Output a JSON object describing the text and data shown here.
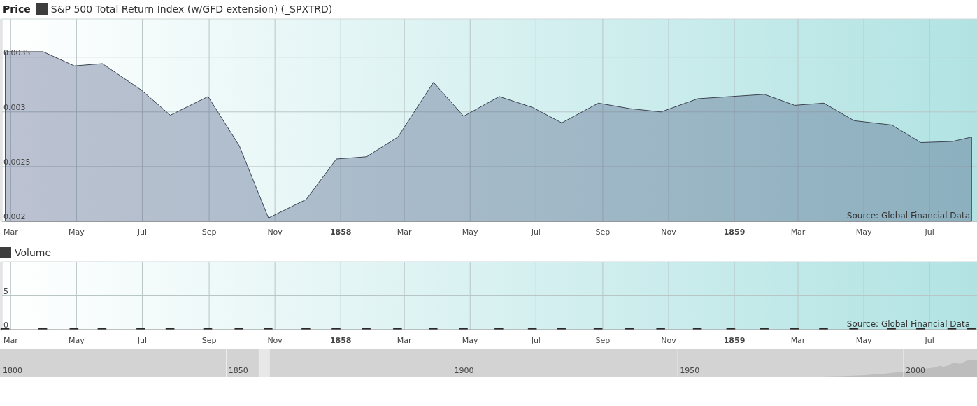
{
  "price_panel": {
    "label": "Price",
    "source": "Source: Global Financial Data",
    "chart_data": {
      "type": "area",
      "grid": true,
      "xlim": [
        "1857-02-21",
        "1859-08-14"
      ],
      "ylim": [
        0.002,
        0.00385
      ],
      "x": [
        "1857-02-24",
        "1857-03-31",
        "1857-04-29",
        "1857-05-25",
        "1857-06-30",
        "1857-07-27",
        "1857-08-31",
        "1857-09-29",
        "1857-10-26",
        "1857-11-30",
        "1857-12-28",
        "1858-01-25",
        "1858-02-23",
        "1858-03-28",
        "1858-04-25",
        "1858-05-28",
        "1858-06-28",
        "1858-07-25",
        "1858-08-28",
        "1858-09-26",
        "1858-10-25",
        "1858-11-28",
        "1858-12-29",
        "1859-01-29",
        "1859-02-26",
        "1859-03-25",
        "1859-04-22",
        "1859-05-27",
        "1859-06-23",
        "1859-07-22",
        "1859-08-09"
      ],
      "series": [
        {
          "name": "S&P 500 Total Return Index (w/GFD extension) (_SPXTRD)",
          "values": [
            0.00355,
            0.00355,
            0.00342,
            0.00344,
            0.0032,
            0.00297,
            0.00314,
            0.00269,
            0.00203,
            0.0022,
            0.00257,
            0.00259,
            0.00277,
            0.00327,
            0.00296,
            0.00314,
            0.00304,
            0.0029,
            0.00308,
            0.00303,
            0.003,
            0.00312,
            0.00314,
            0.00316,
            0.00306,
            0.00308,
            0.00292,
            0.00288,
            0.00272,
            0.00273,
            0.00277
          ]
        }
      ],
      "yticks": [
        {
          "value": 0.002,
          "label": "0.002"
        },
        {
          "value": 0.0025,
          "label": "0.0025"
        },
        {
          "value": 0.003,
          "label": "0.003"
        },
        {
          "value": 0.0035,
          "label": "0.0035"
        }
      ],
      "xticks": [
        {
          "value": "1857-03-01",
          "label": "Mar"
        },
        {
          "value": "1857-05-01",
          "label": "May"
        },
        {
          "value": "1857-07-01",
          "label": "Jul"
        },
        {
          "value": "1857-09-01",
          "label": "Sep"
        },
        {
          "value": "1857-11-01",
          "label": "Nov"
        },
        {
          "value": "1858-01-01",
          "label": "1858"
        },
        {
          "value": "1858-03-01",
          "label": "Mar"
        },
        {
          "value": "1858-05-01",
          "label": "May"
        },
        {
          "value": "1858-07-01",
          "label": "Jul"
        },
        {
          "value": "1858-09-01",
          "label": "Sep"
        },
        {
          "value": "1858-11-01",
          "label": "Nov"
        },
        {
          "value": "1859-01-01",
          "label": "1859"
        },
        {
          "value": "1859-03-01",
          "label": "Mar"
        },
        {
          "value": "1859-05-01",
          "label": "May"
        },
        {
          "value": "1859-07-01",
          "label": "Jul"
        }
      ]
    }
  },
  "volume_panel": {
    "source": "Source: Global Financial Data",
    "chart_data": {
      "type": "bar",
      "grid": true,
      "xlim": [
        "1857-02-21",
        "1859-08-14"
      ],
      "ylim": [
        0,
        10
      ],
      "x": [
        "1857-02-24",
        "1857-03-31",
        "1857-04-29",
        "1857-05-25",
        "1857-06-30",
        "1857-07-27",
        "1857-08-31",
        "1857-09-29",
        "1857-10-26",
        "1857-11-30",
        "1857-12-28",
        "1858-01-25",
        "1858-02-23",
        "1858-03-28",
        "1858-04-25",
        "1858-05-28",
        "1858-06-28",
        "1858-07-25",
        "1858-08-28",
        "1858-09-26",
        "1858-10-25",
        "1858-11-28",
        "1858-12-29",
        "1859-01-29",
        "1859-02-26",
        "1859-03-25",
        "1859-04-22",
        "1859-05-27",
        "1859-06-23",
        "1859-07-22",
        "1859-08-09"
      ],
      "series": [
        {
          "name": "Volume",
          "values": [
            0,
            0,
            0,
            0,
            0,
            0,
            0,
            0,
            0,
            0,
            0,
            0,
            0,
            0,
            0,
            0,
            0,
            0,
            0,
            0,
            0,
            0,
            0,
            0,
            0,
            0,
            0,
            0,
            0,
            0,
            0
          ]
        }
      ],
      "yticks": [
        {
          "value": 0,
          "label": "0"
        },
        {
          "value": 5,
          "label": "5"
        }
      ],
      "xticks": [
        {
          "value": "1857-03-01",
          "label": "Mar"
        },
        {
          "value": "1857-05-01",
          "label": "May"
        },
        {
          "value": "1857-07-01",
          "label": "Jul"
        },
        {
          "value": "1857-09-01",
          "label": "Sep"
        },
        {
          "value": "1857-11-01",
          "label": "Nov"
        },
        {
          "value": "1858-01-01",
          "label": "1858"
        },
        {
          "value": "1858-03-01",
          "label": "Mar"
        },
        {
          "value": "1858-05-01",
          "label": "May"
        },
        {
          "value": "1858-07-01",
          "label": "Jul"
        },
        {
          "value": "1858-09-01",
          "label": "Sep"
        },
        {
          "value": "1858-11-01",
          "label": "Nov"
        },
        {
          "value": "1859-01-01",
          "label": "1859"
        },
        {
          "value": "1859-03-01",
          "label": "Mar"
        },
        {
          "value": "1859-05-01",
          "label": "May"
        },
        {
          "value": "1859-07-01",
          "label": "Jul"
        }
      ]
    }
  },
  "navigator": {
    "labels": [
      {
        "year": "1800"
      },
      {
        "year": "1850"
      },
      {
        "year": "1900"
      },
      {
        "year": "1950"
      },
      {
        "year": "2000"
      }
    ]
  }
}
